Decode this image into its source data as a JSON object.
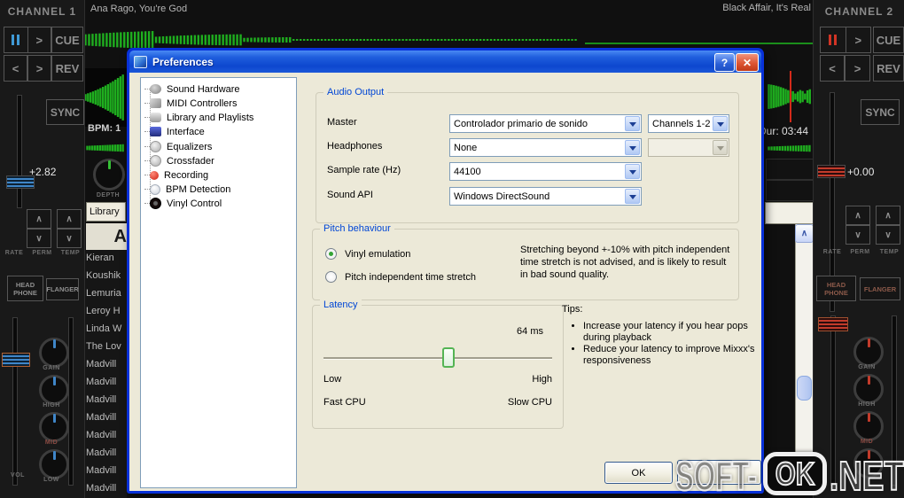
{
  "glyphs": {
    "play": ">",
    "prev": "<",
    "next": ">",
    "up": "∧",
    "down": "∨",
    "help": "?",
    "close": "✕"
  },
  "colors": {
    "waveform_green": "#1fae1f",
    "xp_title_blue": "#0831d9",
    "dialog_bg": "#ece9d8",
    "group_label_blue": "#0046d5",
    "left_accent_blue": "#3f86c8",
    "right_accent_red": "#c23b2b"
  },
  "app": {
    "deck1": {
      "track_title": "Ana Rago, You're God",
      "bpm_label": "BPM: 1"
    },
    "deck2": {
      "track_title": "Black Affair, It's Real",
      "duration_label": "Dur: 03:44"
    },
    "channel1": {
      "title": "CHANNEL 1",
      "cue": "CUE",
      "rev": "REV",
      "sync": "SYNC",
      "pitch_value": "+2.82",
      "rate": "RATE",
      "perm": "PERM",
      "temp": "TEMP",
      "headphone": "HEAD PHONE",
      "flanger": "FLANGER",
      "depth": "DEPTH",
      "vol": "VOL",
      "knobs": [
        "GAIN",
        "HIGH",
        "MID",
        "LOW"
      ]
    },
    "channel2": {
      "title": "CHANNEL 2",
      "cue": "CUE",
      "rev": "REV",
      "sync": "SYNC",
      "pitch_value": "+0.00",
      "rate": "RATE",
      "perm": "PERM",
      "temp": "TEMP",
      "headphone": "HEAD PHONE",
      "flanger": "FLANGER",
      "knobs": [
        "GAIN",
        "HIGH",
        "MID"
      ]
    },
    "library": {
      "tab": "Library",
      "header": "A",
      "rows": [
        "Kieran",
        "Koushik",
        "Lemuria",
        "Leroy H",
        "Linda W",
        "The Lov",
        "Madvill",
        "Madvill",
        "Madvill",
        "Madvill",
        "Madvill",
        "Madvill",
        "Madvill",
        "Madvill"
      ]
    }
  },
  "dialog": {
    "title": "Preferences",
    "tree": {
      "items": [
        {
          "label": "Sound Hardware",
          "icon": "speaker-icon"
        },
        {
          "label": "MIDI Controllers",
          "icon": "midi-icon"
        },
        {
          "label": "Library and Playlists",
          "icon": "library-icon"
        },
        {
          "label": "Interface",
          "icon": "monitor-icon"
        },
        {
          "label": "Equalizers",
          "icon": "knob-icon"
        },
        {
          "label": "Crossfader",
          "icon": "knob-icon"
        },
        {
          "label": "Recording",
          "icon": "record-dot-icon"
        },
        {
          "label": "BPM Detection",
          "icon": "bulb-icon"
        },
        {
          "label": "Vinyl Control",
          "icon": "vinyl-icon"
        }
      ]
    },
    "audio_output": {
      "title": "Audio Output",
      "master_label": "Master",
      "master_value": "Controlador primario de sonido",
      "master_channels_value": "Channels 1-2",
      "headphones_label": "Headphones",
      "headphones_value": "None",
      "sample_rate_label": "Sample rate (Hz)",
      "sample_rate_value": "44100",
      "sound_api_label": "Sound API",
      "sound_api_value": "Windows DirectSound"
    },
    "pitch": {
      "title": "Pitch behaviour",
      "vinyl_option": "Vinyl emulation",
      "stretch_option": "Pitch independent time stretch",
      "note": "Stretching beyond +-10% with pitch independent time stretch is not advised, and is likely to result in bad sound quality."
    },
    "latency": {
      "title": "Latency",
      "value": "64 ms",
      "low": "Low",
      "high": "High",
      "fast_cpu": "Fast CPU",
      "slow_cpu": "Slow CPU"
    },
    "tips": {
      "title": "Tips:",
      "items": [
        "Increase your latency if you hear pops during playback",
        "Reduce your latency to improve Mixxx's responsiveness"
      ]
    },
    "ok_label": "OK"
  },
  "watermark": {
    "prefix": "SOFT-",
    "ok": "OK",
    "suffix": ".NET"
  }
}
